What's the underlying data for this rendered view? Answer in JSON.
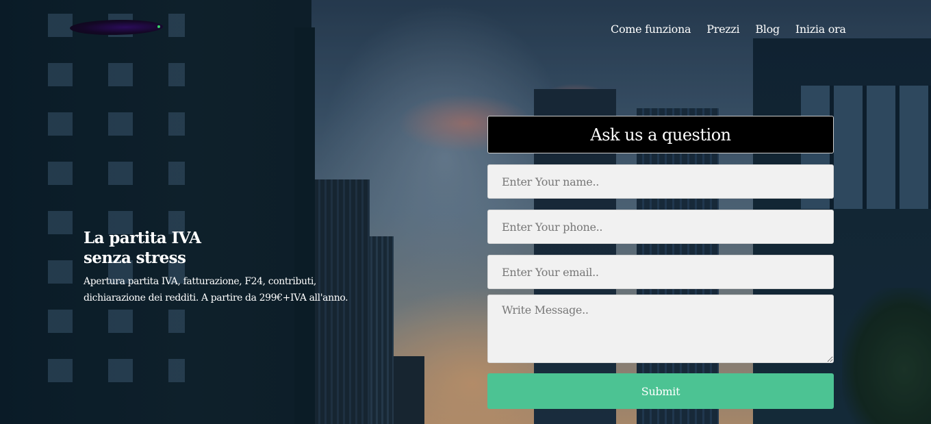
{
  "nav": {
    "items": [
      {
        "label": "Come funziona"
      },
      {
        "label": "Prezzi"
      },
      {
        "label": "Blog"
      },
      {
        "label": "Inizia ora"
      }
    ]
  },
  "hero": {
    "title": "La partita IVA senza stress",
    "subtitle": "Apertura partita IVA, fatturazione, F24, contributi, dichiarazione dei redditi. A partire da 299€+IVA all'anno."
  },
  "form": {
    "title": "Ask us a question",
    "name_placeholder": "Enter Your name..",
    "phone_placeholder": "Enter Your phone..",
    "email_placeholder": "Enter Your email..",
    "message_placeholder": "Write Message..",
    "submit_label": "Submit"
  },
  "colors": {
    "submit": "#4cc393",
    "form_title_bg": "#000000",
    "field_bg": "#f1f1f1"
  },
  "icons": {
    "logo": "brand-logo"
  }
}
